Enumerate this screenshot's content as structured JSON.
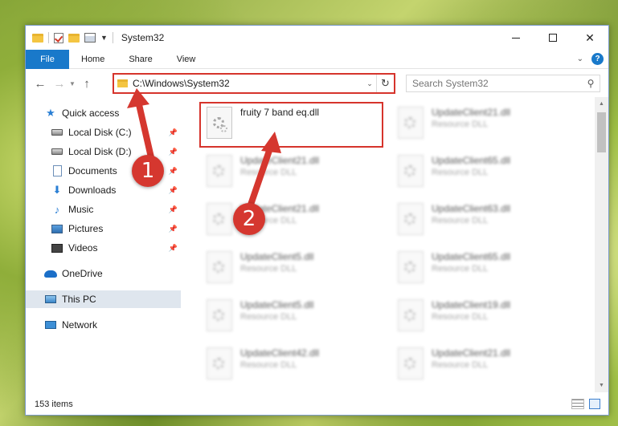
{
  "window": {
    "title": "System32",
    "colors": {
      "accent": "#1979ca",
      "highlight": "#d6342c",
      "selected": "#dfe6ee"
    }
  },
  "ribbon": {
    "file": "File",
    "home": "Home",
    "share": "Share",
    "view": "View",
    "help": "?"
  },
  "nav": {
    "back_icon": "←",
    "forward_icon": "→",
    "up_icon": "↑",
    "address": "C:\\Windows\\System32",
    "refresh_icon": "↻",
    "search_placeholder": "Search System32"
  },
  "sidebar": {
    "items": [
      {
        "label": "Quick access",
        "icon": "star-icon",
        "pinned": false
      },
      {
        "label": "Local Disk (C:)",
        "icon": "disk-icon",
        "pinned": true
      },
      {
        "label": "Local Disk (D:)",
        "icon": "disk-icon",
        "pinned": true
      },
      {
        "label": "Documents",
        "icon": "documents-icon",
        "pinned": true
      },
      {
        "label": "Downloads",
        "icon": "download-icon",
        "pinned": true
      },
      {
        "label": "Music",
        "icon": "music-icon",
        "pinned": true
      },
      {
        "label": "Pictures",
        "icon": "pictures-icon",
        "pinned": true
      },
      {
        "label": "Videos",
        "icon": "videos-icon",
        "pinned": true
      },
      {
        "label": "OneDrive",
        "icon": "onedrive-icon",
        "pinned": false
      },
      {
        "label": "This PC",
        "icon": "pc-icon",
        "pinned": false,
        "selected": true
      },
      {
        "label": "Network",
        "icon": "network-icon",
        "pinned": false
      }
    ]
  },
  "files": [
    {
      "name": "fruity 7 band eq.dll",
      "type": ""
    },
    {
      "name": "UpdateClient21.dll",
      "type": "Resource DLL"
    },
    {
      "name": "UpdateClient21.dll",
      "type": "Resource DLL"
    },
    {
      "name": "UpdateClient65.dll",
      "type": "Resource DLL"
    },
    {
      "name": "UpdateClient21.dll",
      "type": "Resource DLL"
    },
    {
      "name": "UpdateClient63.dll",
      "type": "Resource DLL"
    },
    {
      "name": "UpdateClient5.dll",
      "type": "Resource DLL"
    },
    {
      "name": "UpdateClient65.dll",
      "type": "Resource DLL"
    },
    {
      "name": "UpdateClient5.dll",
      "type": "Resource DLL"
    },
    {
      "name": "UpdateClient19.dll",
      "type": "Resource DLL"
    },
    {
      "name": "UpdateClient42.dll",
      "type": "Resource DLL"
    },
    {
      "name": "UpdateClient21.dll",
      "type": "Resource DLL"
    }
  ],
  "status": {
    "item_count": "153 items"
  },
  "annotations": {
    "callout1": "1",
    "callout2": "2"
  }
}
